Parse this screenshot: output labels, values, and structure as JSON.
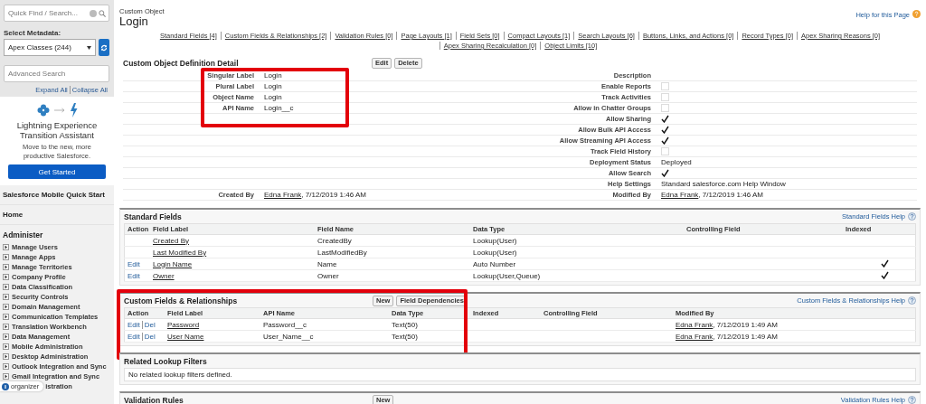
{
  "sidebar": {
    "quick_find": {
      "placeholder": "Quick Find / Search..."
    },
    "metadata_label": "Select Metadata:",
    "metadata_select": {
      "value": "Apex Classes (244)"
    },
    "advanced_search": {
      "placeholder": "Advanced Search"
    },
    "tree_links": [
      "Expand All",
      "Collapse All"
    ],
    "promo": {
      "title": "Lightning Experience Transition Assistant",
      "text": "Move to the new, more productive Salesforce.",
      "button": "Get Started"
    },
    "nav": [
      {
        "label": "Salesforce Mobile Quick Start"
      },
      {
        "label": "Home"
      }
    ],
    "section": "Administer",
    "items": [
      {
        "label": "Manage Users",
        "expanded": false
      },
      {
        "label": "Manage Apps",
        "expanded": false
      },
      {
        "label": "Manage Territories",
        "expanded": false
      },
      {
        "label": "Company Profile",
        "expanded": false
      },
      {
        "label": "Data Classification",
        "expanded": false
      },
      {
        "label": "Security Controls",
        "expanded": false
      },
      {
        "label": "Domain Management",
        "expanded": false
      },
      {
        "label": "Communication Templates",
        "expanded": false
      },
      {
        "label": "Translation Workbench",
        "expanded": false
      },
      {
        "label": "Data Management",
        "expanded": false
      },
      {
        "label": "Mobile Administration",
        "expanded": false
      },
      {
        "label": "Desktop Administration",
        "expanded": false
      },
      {
        "label": "Outlook Integration and Sync",
        "expanded": false
      },
      {
        "label": "Gmail Integration and Sync",
        "expanded": false
      }
    ],
    "badge": {
      "label": "organizer",
      "partial_item": "istration"
    }
  },
  "header": {
    "type": "Custom Object",
    "title": "Login",
    "help": "Help for this Page"
  },
  "links": [
    {
      "label": "Standard Fields",
      "count": "[4]"
    },
    {
      "label": "Custom Fields & Relationships",
      "count": "[2]"
    },
    {
      "label": "Validation Rules",
      "count": "[0]"
    },
    {
      "label": "Page Layouts",
      "count": "[1]"
    },
    {
      "label": "Field Sets",
      "count": "[0]"
    },
    {
      "label": "Compact Layouts",
      "count": "[1]"
    },
    {
      "label": "Search Layouts",
      "count": "[6]"
    },
    {
      "label": "Buttons, Links, and Actions",
      "count": "[0]"
    },
    {
      "label": "Record Types",
      "count": "[0]"
    },
    {
      "label": "Apex Sharing Reasons",
      "count": "[0]"
    },
    {
      "label": "Apex Sharing Recalculation",
      "count": "[0]"
    },
    {
      "label": "Object Limits",
      "count": "[10]"
    }
  ],
  "detail": {
    "title": "Custom Object Definition Detail",
    "buttons": [
      "Edit",
      "Delete"
    ],
    "names_highlighted": true,
    "names": [
      {
        "label": "Singular Label",
        "value": "Login"
      },
      {
        "label": "Plural Label",
        "value": "Login"
      },
      {
        "label": "Object Name",
        "value": "Login"
      },
      {
        "label": "API Name",
        "value": "Login__c"
      }
    ],
    "created": {
      "label": "Created By",
      "user": "Edna Frank",
      "date": ", 7/12/2019 1:46 AM"
    },
    "properties": [
      {
        "label": "Description",
        "kind": "text"
      },
      {
        "label": "Enable Reports",
        "kind": "checkbox",
        "checked": false
      },
      {
        "label": "Track Activities",
        "kind": "checkbox",
        "checked": false
      },
      {
        "label": "Allow in Chatter Groups",
        "kind": "checkbox",
        "checked": false
      },
      {
        "label": "Allow Sharing",
        "kind": "checkbox",
        "checked": true
      },
      {
        "label": "Allow Bulk API Access",
        "kind": "checkbox",
        "checked": true
      },
      {
        "label": "Allow Streaming API Access",
        "kind": "checkbox",
        "checked": true
      },
      {
        "label": "Track Field History",
        "kind": "checkbox",
        "checked": false
      },
      {
        "label": "Deployment Status",
        "kind": "text",
        "value": "Deployed"
      },
      {
        "label": "Allow Search",
        "kind": "checkbox",
        "checked": true
      },
      {
        "label": "Help Settings",
        "kind": "text",
        "value": "Standard salesforce.com Help Window"
      },
      {
        "label": "Modified By",
        "kind": "user",
        "user": "Edna Frank",
        "date": ", 7/12/2019 1:46 AM"
      }
    ]
  },
  "standard_fields": {
    "title": "Standard Fields",
    "help": "Standard Fields Help",
    "columns": [
      "Action",
      "Field Label",
      "Field Name",
      "Data Type",
      "Controlling Field",
      "Indexed"
    ],
    "rows": [
      {
        "field_label": "Created By",
        "field_name": "CreatedBy",
        "data_type": "Lookup(User)",
        "indexed": false
      },
      {
        "field_label": "Last Modified By",
        "field_name": "LastModifiedBy",
        "data_type": "Lookup(User)",
        "indexed": false
      },
      {
        "actions": [
          "Edit"
        ],
        "field_label": "Login Name",
        "field_name": "Name",
        "data_type": "Auto Number",
        "indexed": true
      },
      {
        "actions": [
          "Edit"
        ],
        "field_label": "Owner",
        "field_name": "Owner",
        "data_type": "Lookup(User,Queue)",
        "indexed": true
      }
    ]
  },
  "custom_fields": {
    "title": "Custom Fields & Relationships",
    "buttons": [
      "New",
      "Field Dependencies"
    ],
    "help": "Custom Fields & Relationships Help",
    "highlighted": true,
    "columns": [
      "Action",
      "Field Label",
      "API Name",
      "Data Type",
      "Indexed",
      "Controlling Field",
      "Modified By"
    ],
    "rows": [
      {
        "actions": [
          "Edit",
          "Del"
        ],
        "field_label": "Password",
        "api_name": "Password__c",
        "data_type": "Text(50)",
        "modified_user": "Edna Frank",
        "modified_date": ", 7/12/2019 1:49 AM"
      },
      {
        "actions": [
          "Edit",
          "Del"
        ],
        "field_label": "User Name",
        "api_name": "User_Name__c",
        "data_type": "Text(50)",
        "modified_user": "Edna Frank",
        "modified_date": ", 7/12/2019 1:49 AM"
      }
    ]
  },
  "lookup_filters": {
    "title": "Related Lookup Filters",
    "message": "No related lookup filters defined."
  },
  "validation_rules": {
    "title": "Validation Rules",
    "button": "New",
    "help": "Validation Rules Help"
  }
}
